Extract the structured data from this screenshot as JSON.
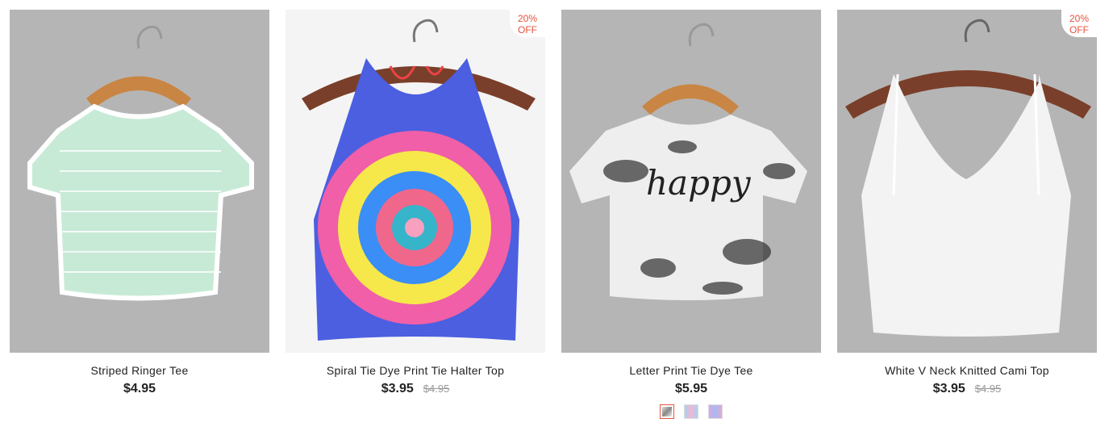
{
  "products": [
    {
      "name": "Striped Ringer Tee",
      "price": "$4.95",
      "orig_price": "",
      "badge": "",
      "bg": "gray"
    },
    {
      "name": "Spiral Tie Dye Print Tie Halter Top",
      "price": "$3.95",
      "orig_price": "$4.95",
      "badge_line1": "20%",
      "badge_line2": "OFF",
      "bg": "white"
    },
    {
      "name": "Letter Print Tie Dye Tee",
      "price": "$5.95",
      "orig_price": "",
      "shirt_text": "happy",
      "bg": "gray",
      "swatches": [
        "tie-dye-black",
        "tie-dye-blue-pink",
        "tie-dye-pink-blue"
      ]
    },
    {
      "name": "White V Neck Knitted Cami Top",
      "price": "$3.95",
      "orig_price": "$4.95",
      "badge_line1": "20%",
      "badge_line2": "OFF",
      "bg": "gray"
    }
  ],
  "colors": {
    "accent": "#e5533d",
    "mint": "#c7ead6",
    "hanger": "#7a3f2a"
  }
}
